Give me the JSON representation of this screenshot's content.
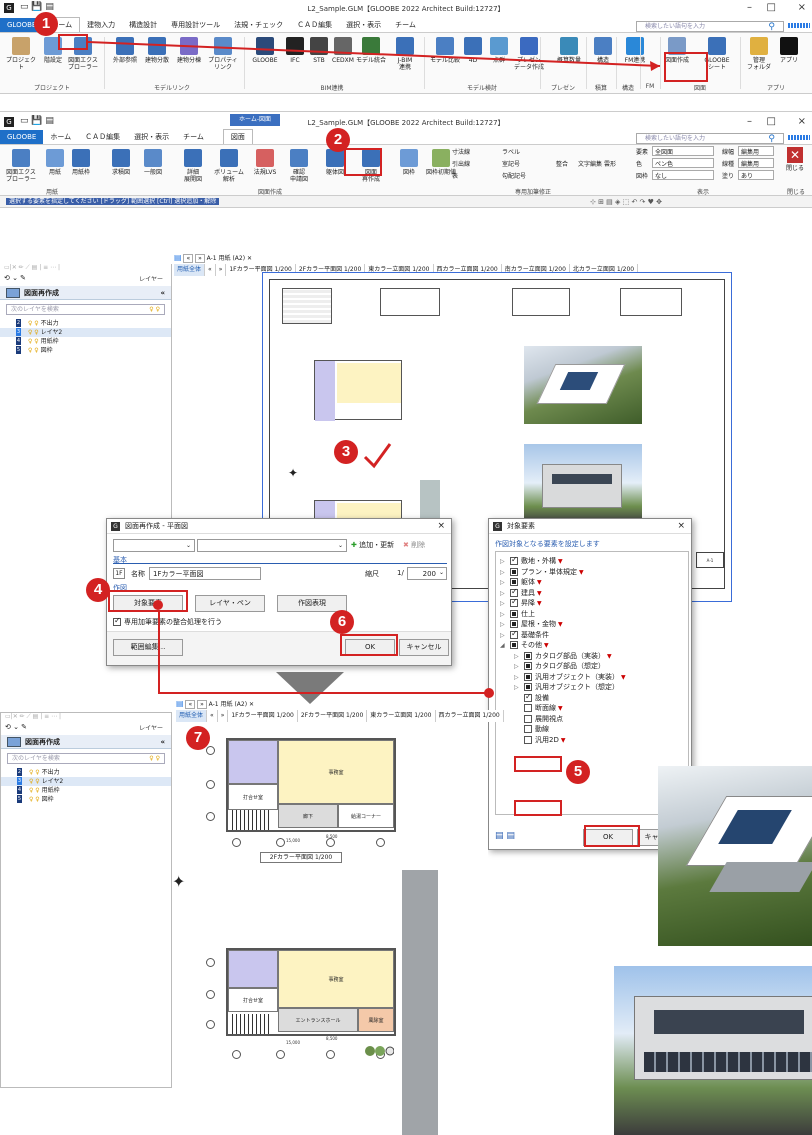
{
  "win1": {
    "title": "L2_Sample.GLM【GLOOBE 2022 Architect Build:12727】",
    "tabs": [
      "GLOOBE",
      "ホーム",
      "建物入力",
      "構造設計",
      "専用設計ツール",
      "法規・チェック",
      "ＣＡＤ編集",
      "選択・表示",
      "チーム"
    ],
    "search_placeholder": "検索したい語句を入力",
    "ribbon_buttons": [
      "プロジェクト",
      "階設定",
      "図面エクス\nプローラー",
      "外部参照",
      "建物分散",
      "建物分棟",
      "プロパティ\nリンク",
      "GLOOBE",
      "IFC",
      "STB",
      "CEDXM",
      "モデル統合",
      "J-BIM\n連携",
      "モデル比較",
      "4D",
      "点群",
      "プレゼン\nデータ作成",
      "概算数量",
      "構造",
      "FM連携",
      "図面作成",
      "GLOOBE\nシート",
      "管理\nフォルダ",
      "アプリ"
    ],
    "groups": [
      "プロジェクト",
      "モデルリンク",
      "BIM連携",
      "モデル検討",
      "プレゼン",
      "積算",
      "構造",
      "FM",
      "図面",
      "アプリ"
    ]
  },
  "win2": {
    "title": "L2_Sample.GLM【GLOOBE 2022 Architect Build:12727】",
    "context_tab": "ホーム-図面",
    "tabs": [
      "GLOOBE",
      "ホーム",
      "ＣＡＤ編集",
      "選択・表示",
      "チーム",
      "図面"
    ],
    "search_placeholder": "検索したい語句を入力",
    "ribbon_buttons": [
      "図面エクス\nプローラー",
      "用紙",
      "用紙枠",
      "求積図",
      "一般図",
      "詳細\n展開図",
      "ボリューム\n解析",
      "法規LVS",
      "確認\n申請図",
      "躯体図",
      "図面\n再作成",
      "図枠",
      "図枠初期値"
    ],
    "annot_items": [
      "寸法線",
      "ラベル",
      "引出線",
      "室記号",
      "表",
      "勾配記号",
      "整合",
      "文字編集",
      "雲形"
    ],
    "display": {
      "layer_label": "要素",
      "layer_value": "全図面",
      "color_label": "色",
      "color_value": "ペン色",
      "frame_label": "図枠",
      "frame_value": "なし",
      "line_label": "線幅",
      "line_value": "編集用",
      "linetype_label": "線種",
      "linetype_value": "編集用",
      "fill_label": "塗り",
      "fill_value": "あり",
      "close": "閉じる"
    },
    "groups": [
      "用紙",
      "図面作成",
      "専用加筆修正",
      "表示",
      "閉じる"
    ],
    "status_strip": "選択する要素を指定してください [ドラッグ] 範囲選択 [Ctrl] 選択追加・解除",
    "layer_mode": "レイヤー",
    "panel_title": "図面再作成",
    "layer_search": "次のレイヤを検索",
    "layers": [
      "不出力",
      "レイヤ2",
      "用紙枠",
      "図枠"
    ],
    "sheet_name": "A-1 用紙 (A2)",
    "drawing_tabs": [
      "用紙全体",
      "1Fカラー平面図 1/200",
      "2Fカラー平面図 1/200",
      "東カラー立面図 1/200",
      "西カラー立面図 1/200",
      "南カラー立面図 1/200",
      "北カラー立面図 1/200"
    ]
  },
  "dialog1": {
    "title": "図面再作成 - 平面図",
    "add_update": "追加・更新",
    "delete": "削除",
    "section_basic": "基本",
    "floor_badge": "1F",
    "name_label": "名称",
    "name_value": "1Fカラー平面図",
    "scale_label": "縮尺",
    "scale_prefix": "1/",
    "scale_value": "200",
    "section_fig": "作図",
    "btn_target": "対象要素",
    "btn_layer_pen": "レイヤ・ペン",
    "btn_expression": "作図表現",
    "check_consistency": "専用加筆要素の整合処理を行う",
    "btn_range": "範囲編集...",
    "ok": "OK",
    "cancel": "キャンセル"
  },
  "dialog2": {
    "title": "対象要素",
    "subtitle": "作図対象となる要素を設定します",
    "items": [
      {
        "label": "敷地・外構",
        "state": "on",
        "mark": true,
        "indent": 0
      },
      {
        "label": "プラン・単体規定",
        "state": "partial",
        "mark": true,
        "indent": 0
      },
      {
        "label": "躯体",
        "state": "partial",
        "mark": true,
        "indent": 0
      },
      {
        "label": "建具",
        "state": "on",
        "mark": true,
        "indent": 0
      },
      {
        "label": "昇降",
        "state": "on",
        "mark": true,
        "indent": 0
      },
      {
        "label": "仕上",
        "state": "partial",
        "mark": false,
        "indent": 0
      },
      {
        "label": "屋根・金物",
        "state": "partial",
        "mark": true,
        "indent": 0
      },
      {
        "label": "基礎条件",
        "state": "on",
        "mark": false,
        "indent": 0
      },
      {
        "label": "その他",
        "state": "partial",
        "mark": true,
        "indent": 0
      },
      {
        "label": "カタログ部品（実装）",
        "state": "partial",
        "mark": true,
        "indent": 1
      },
      {
        "label": "カタログ部品（想定）",
        "state": "partial",
        "mark": false,
        "indent": 1
      },
      {
        "label": "汎用オブジェクト（実装）",
        "state": "partial",
        "mark": true,
        "indent": 1
      },
      {
        "label": "汎用オブジェクト（想定）",
        "state": "partial",
        "mark": false,
        "indent": 1
      },
      {
        "label": "設備",
        "state": "on",
        "mark": false,
        "indent": 1
      },
      {
        "label": "断面線",
        "state": "off",
        "mark": true,
        "indent": 1
      },
      {
        "label": "展開視点",
        "state": "off",
        "mark": false,
        "indent": 1
      },
      {
        "label": "動線",
        "state": "off",
        "mark": false,
        "indent": 1
      },
      {
        "label": "汎用2D",
        "state": "off",
        "mark": true,
        "indent": 1
      }
    ],
    "ok": "OK",
    "cancel": "キャンセル"
  },
  "bottom": {
    "sheet_name": "A-1 用紙 (A2)",
    "drawing_tabs": [
      "用紙全体",
      "1Fカラー平面図 1/200",
      "2Fカラー平面図 1/200",
      "東カラー立面図 1/200",
      "西カラー立面図 1/200"
    ],
    "panel_title": "図面再作成",
    "layer_search": "次のレイヤを検索",
    "layers": [
      "不出力",
      "レイヤ2",
      "用紙枠",
      "図枠"
    ],
    "layer_mode": "レイヤー",
    "plan2f_caption": "2Fカラー平面図 1/200",
    "rooms_2f": [
      "事務室",
      "打合せ室",
      "廊下",
      "給湯コーナー"
    ],
    "rooms_1f": [
      "事務室",
      "打合せ室",
      "エントランスホール",
      "風除室"
    ],
    "dim_total": "15,000",
    "dim_mid": "8,500"
  },
  "badges": [
    "1",
    "2",
    "3",
    "4",
    "5",
    "6",
    "7"
  ],
  "colors": {
    "accent_red": "#d32222",
    "tab_blue": "#1e6fc8",
    "office": "#fdf3c2",
    "meeting": "#c9c6ee",
    "corridor": "#dcdcdc"
  }
}
